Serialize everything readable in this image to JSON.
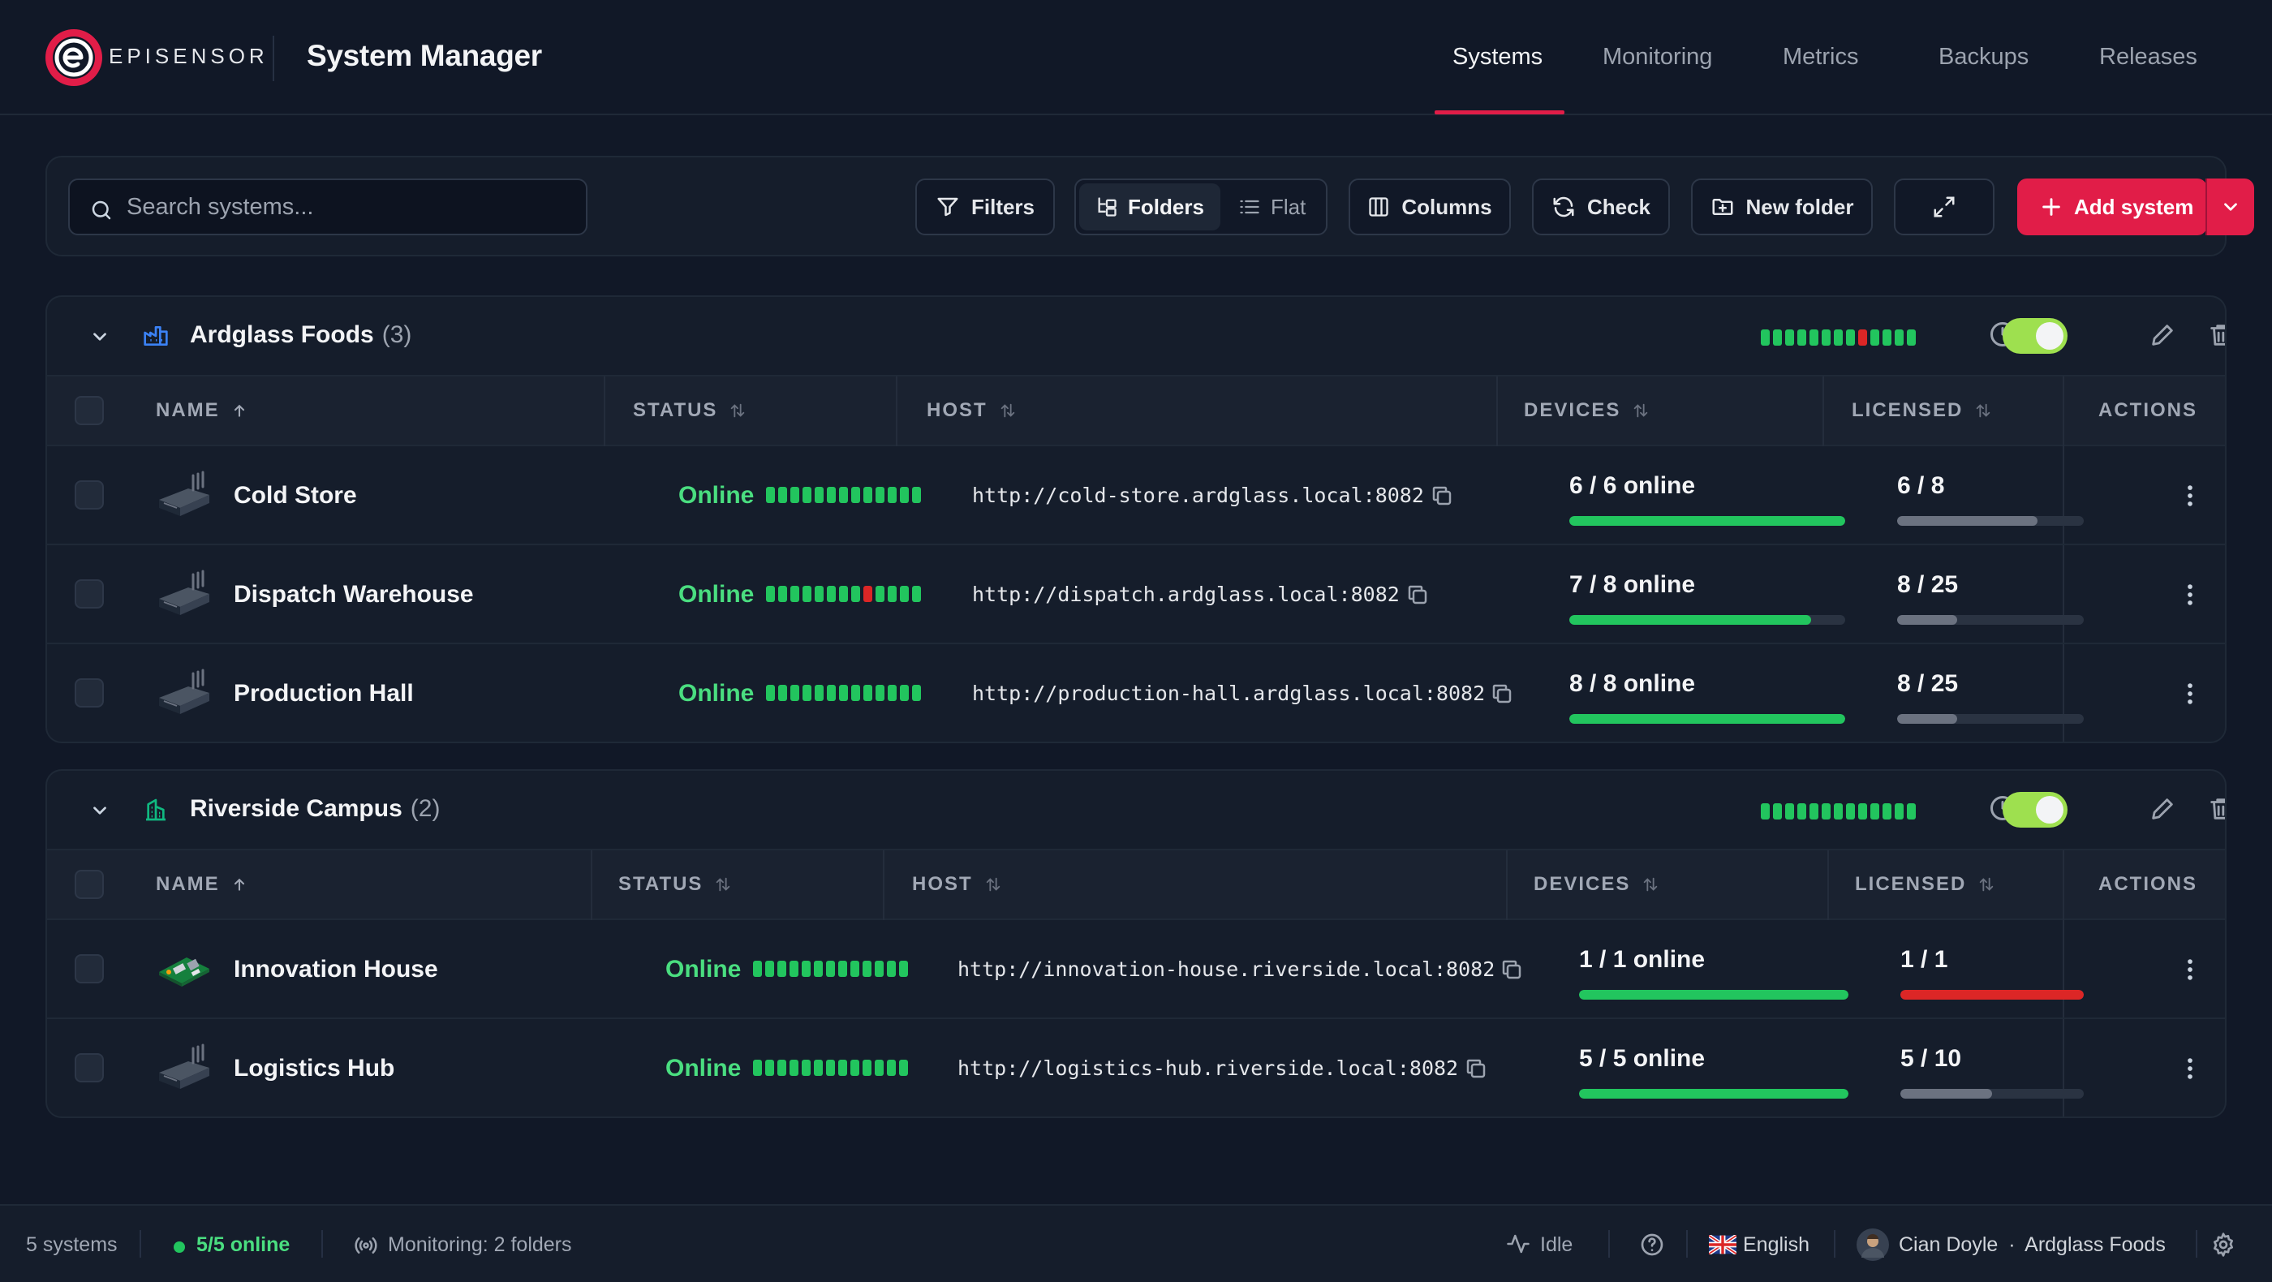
{
  "brand": {
    "name": "EPISENSOR",
    "app_title": "System Manager",
    "accent": "#e11d48"
  },
  "nav": {
    "items": [
      {
        "label": "Systems",
        "active": true
      },
      {
        "label": "Monitoring",
        "active": false
      },
      {
        "label": "Metrics",
        "active": false
      },
      {
        "label": "Backups",
        "active": false
      },
      {
        "label": "Releases",
        "active": false
      }
    ]
  },
  "toolbar": {
    "search_placeholder": "Search systems...",
    "filters_label": "Filters",
    "view_folders_label": "Folders",
    "view_flat_label": "Flat",
    "view_selected": "Folders",
    "columns_label": "Columns",
    "check_label": "Check",
    "new_folder_label": "New folder",
    "add_system_label": "Add system"
  },
  "columns": {
    "name": "NAME",
    "status": "STATUS",
    "host": "HOST",
    "devices": "DEVICES",
    "licensed": "LICENSED",
    "actions": "ACTIONS"
  },
  "folders": [
    {
      "name": "Ardglass Foods",
      "count": "(3)",
      "icon": "factory-icon",
      "icon_color": "#3b82f6",
      "monitoring_enabled": true,
      "health_bars": [
        "ok",
        "ok",
        "ok",
        "ok",
        "ok",
        "ok",
        "ok",
        "ok",
        "bad",
        "ok",
        "ok",
        "ok",
        "ok"
      ],
      "systems": [
        {
          "name": "Cold Store",
          "thumb": "gateway-icon",
          "status": "Online",
          "health_bars": [
            "ok",
            "ok",
            "ok",
            "ok",
            "ok",
            "ok",
            "ok",
            "ok",
            "ok",
            "ok",
            "ok",
            "ok",
            "ok"
          ],
          "host": "http://cold-store.ardglass.local:8082",
          "devices_text": "6 / 6 online",
          "devices_fraction": 1.0,
          "licensed_text": "6 / 8",
          "licensed_fraction": 0.75
        },
        {
          "name": "Dispatch Warehouse",
          "thumb": "gateway-icon",
          "status": "Online",
          "health_bars": [
            "ok",
            "ok",
            "ok",
            "ok",
            "ok",
            "ok",
            "ok",
            "ok",
            "bad",
            "ok",
            "ok",
            "ok",
            "ok"
          ],
          "host": "http://dispatch.ardglass.local:8082",
          "devices_text": "7 / 8 online",
          "devices_fraction": 0.875,
          "licensed_text": "8 / 25",
          "licensed_fraction": 0.32
        },
        {
          "name": "Production Hall",
          "thumb": "gateway-icon",
          "status": "Online",
          "health_bars": [
            "ok",
            "ok",
            "ok",
            "ok",
            "ok",
            "ok",
            "ok",
            "ok",
            "ok",
            "ok",
            "ok",
            "ok",
            "ok"
          ],
          "host": "http://production-hall.ardglass.local:8082",
          "devices_text": "8 / 8 online",
          "devices_fraction": 1.0,
          "licensed_text": "8 / 25",
          "licensed_fraction": 0.32
        }
      ]
    },
    {
      "name": "Riverside Campus",
      "count": "(2)",
      "icon": "building-icon",
      "icon_color": "#10b981",
      "monitoring_enabled": true,
      "health_bars": [
        "ok",
        "ok",
        "ok",
        "ok",
        "ok",
        "ok",
        "ok",
        "ok",
        "ok",
        "ok",
        "ok",
        "ok",
        "ok"
      ],
      "systems": [
        {
          "name": "Innovation House",
          "thumb": "raspberry-pi-icon",
          "status": "Online",
          "health_bars": [
            "ok",
            "ok",
            "ok",
            "ok",
            "ok",
            "ok",
            "ok",
            "ok",
            "ok",
            "ok",
            "ok",
            "ok",
            "ok"
          ],
          "host": "http://innovation-house.riverside.local:8082",
          "devices_text": "1 / 1 online",
          "devices_fraction": 1.0,
          "licensed_text": "1 / 1",
          "licensed_fraction": 1.0
        },
        {
          "name": "Logistics Hub",
          "thumb": "gateway-icon",
          "status": "Online",
          "health_bars": [
            "ok",
            "ok",
            "ok",
            "ok",
            "ok",
            "ok",
            "ok",
            "ok",
            "ok",
            "ok",
            "ok",
            "ok",
            "ok"
          ],
          "host": "http://logistics-hub.riverside.local:8082",
          "devices_text": "5 / 5 online",
          "devices_fraction": 1.0,
          "licensed_text": "5 / 10",
          "licensed_fraction": 0.5
        }
      ]
    }
  ],
  "footer": {
    "systems_count": "5 systems",
    "online_summary": "5/5 online",
    "monitoring_text": "Monitoring: 2 folders",
    "activity": "Idle",
    "language": "English",
    "user_name": "Cian Doyle",
    "user_org": "Ardglass Foods",
    "separator": "·"
  },
  "colors": {
    "online": "#4ade80",
    "ok_bar": "#22c55e",
    "bad_bar": "#dc2626",
    "license_full": "#dc2626",
    "license_partial": "#6b7280"
  }
}
